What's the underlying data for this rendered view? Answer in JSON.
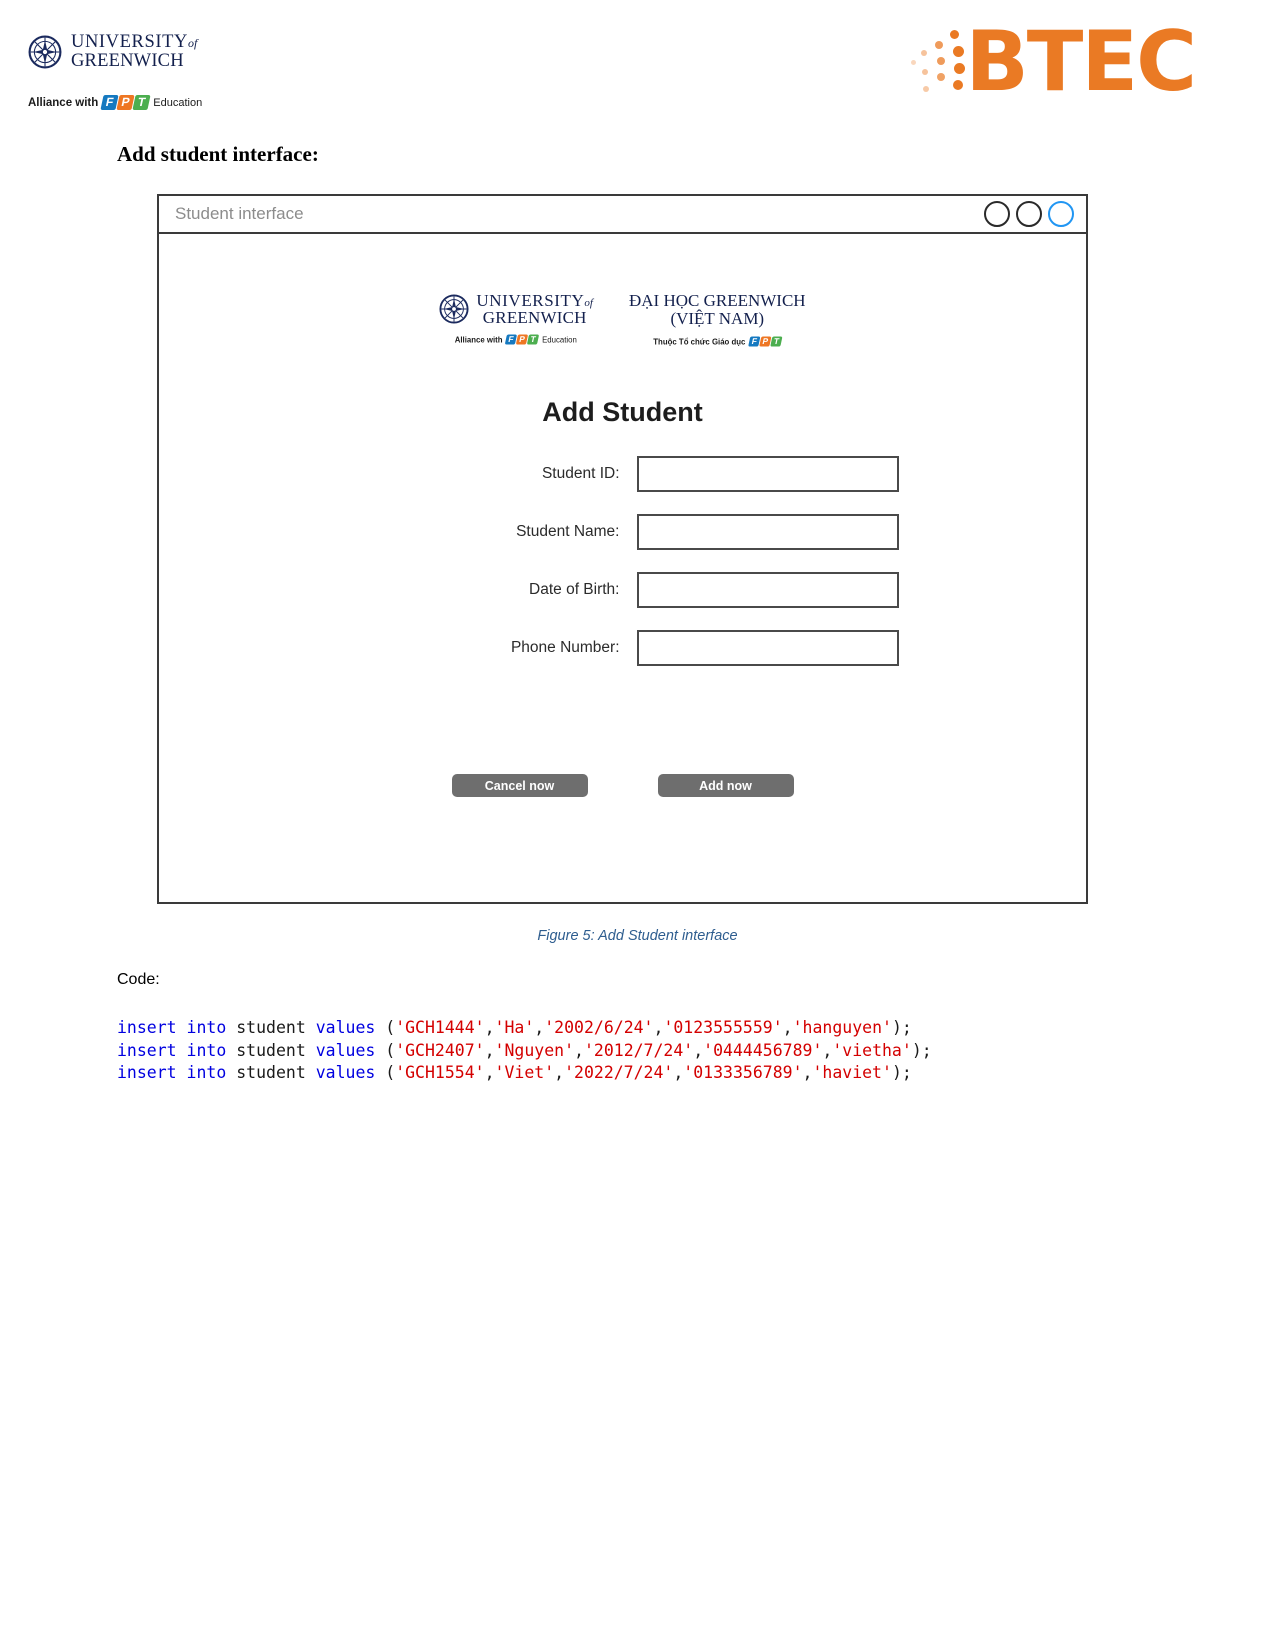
{
  "page_header": {
    "university": {
      "line1": "UNIVERSITY",
      "of": "of",
      "line2": "GREENWICH",
      "alliance_prefix": "Alliance with",
      "fpt": [
        "F",
        "P",
        "T"
      ],
      "alliance_suffix": "Education"
    },
    "btec": {
      "wordmark": "BTEC",
      "color": "#ea7a24"
    }
  },
  "document": {
    "heading": "Add student interface:",
    "figure_caption": "Figure 5: Add Student interface",
    "code_label": "Code:"
  },
  "mockup": {
    "titlebar": {
      "title": "Student interface",
      "controls": [
        {
          "name": "minimize",
          "accent": false
        },
        {
          "name": "maximize",
          "accent": false
        },
        {
          "name": "close",
          "accent": true
        }
      ],
      "accent_color": "#2196f3"
    },
    "branding": {
      "en": {
        "line1": "UNIVERSITY",
        "of": "of",
        "line2": "GREENWICH",
        "tagline_prefix": "Alliance with",
        "fpt": [
          "F",
          "P",
          "T"
        ],
        "tagline_suffix": "Education"
      },
      "vn": {
        "line1": "ĐẠI HỌC GREENWICH",
        "line2": "(VIỆT NAM)",
        "tagline_prefix": "Thuộc Tổ chức Giáo dục",
        "fpt": [
          "F",
          "P",
          "T"
        ],
        "tagline_suffix": ""
      }
    },
    "form": {
      "title": "Add Student",
      "fields": [
        {
          "label": "Student ID:",
          "value": "",
          "placeholder": ""
        },
        {
          "label": "Student Name:",
          "value": "",
          "placeholder": ""
        },
        {
          "label": "Date of Birth:",
          "value": "",
          "placeholder": ""
        },
        {
          "label": "Phone Number:",
          "value": "",
          "placeholder": ""
        }
      ],
      "buttons": {
        "cancel": "Cancel now",
        "submit": "Add now"
      }
    }
  },
  "code": {
    "lines": [
      {
        "keyword1": "insert",
        "keyword2": "into",
        "table": "student",
        "keyword3": "values",
        "open": "(",
        "args": [
          "'GCH1444'",
          "'Ha'",
          "'2002/6/24'",
          "'0123555559'",
          "'hanguyen'"
        ],
        "close": ");"
      },
      {
        "keyword1": "insert",
        "keyword2": "into",
        "table": "student",
        "keyword3": "values",
        "open": "(",
        "args": [
          "'GCH2407'",
          "'Nguyen'",
          "'2012/7/24'",
          "'0444456789'",
          "'vietha'"
        ],
        "close": ");"
      },
      {
        "keyword1": "insert",
        "keyword2": "into",
        "table": "student",
        "keyword3": "values",
        "open": "(",
        "args": [
          "'GCH1554'",
          "'Viet'",
          "'2022/7/24'",
          "'0133356789'",
          "'haviet'"
        ],
        "close": ");"
      }
    ]
  }
}
